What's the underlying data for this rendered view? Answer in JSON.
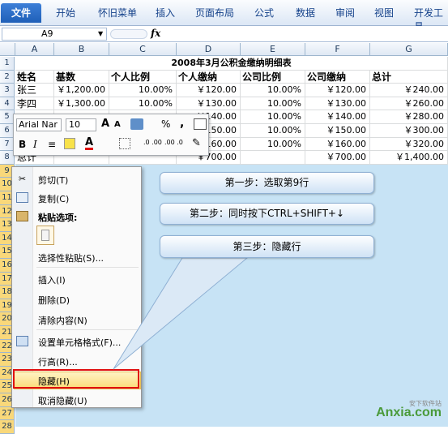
{
  "ribbon": {
    "file_tab": "文件",
    "tabs": [
      "开始",
      "怀旧菜单",
      "插入",
      "页面布局",
      "公式",
      "数据",
      "审阅",
      "视图",
      "开发工具"
    ]
  },
  "formula_bar": {
    "name_box": "A9",
    "fx": "fx"
  },
  "columns": [
    "A",
    "B",
    "C",
    "D",
    "E",
    "F",
    "G"
  ],
  "rows": [
    "1",
    "2",
    "3",
    "4",
    "5",
    "6",
    "7",
    "8",
    "9",
    "10",
    "11",
    "12",
    "13",
    "14",
    "15",
    "16",
    "17",
    "18",
    "19",
    "20",
    "21",
    "22",
    "23",
    "24",
    "25",
    "26",
    "27",
    "28"
  ],
  "sheet": {
    "title": "2008年3月公积金缴纳明细表",
    "headers": [
      "姓名",
      "基数",
      "个人比例",
      "个人缴纳",
      "公司比例",
      "公司缴纳",
      "总计"
    ],
    "data": [
      [
        "张三",
        "￥1,200.00",
        "10.00%",
        "￥120.00",
        "10.00%",
        "￥120.00",
        "￥240.00"
      ],
      [
        "李四",
        "￥1,300.00",
        "10.00%",
        "￥130.00",
        "10.00%",
        "￥130.00",
        "￥260.00"
      ],
      [
        "",
        "",
        "",
        "￥140.00",
        "10.00%",
        "￥140.00",
        "￥280.00"
      ],
      [
        "",
        "",
        "",
        "￥150.00",
        "10.00%",
        "￥150.00",
        "￥300.00"
      ],
      [
        "",
        "",
        "",
        "￥160.00",
        "10.00%",
        "￥160.00",
        "￥320.00"
      ],
      [
        "总计",
        "",
        "",
        "￥700.00",
        "",
        "￥700.00",
        "￥1,400.00"
      ]
    ]
  },
  "mini_toolbar": {
    "font": "Arial Nar",
    "size": "10",
    "grow": "A",
    "shrink": "A",
    "percent": "%",
    "comma": ",",
    "bold": "B",
    "italic": "I",
    "font_color": "A",
    "inc_decimal": ".0 .00",
    "dec_decimal": ".00 .0"
  },
  "context_menu": {
    "items": [
      {
        "label": "剪切(T)",
        "icon": "scissors-icon"
      },
      {
        "label": "复制(C)",
        "icon": "copy-icon"
      },
      {
        "label": "粘贴选项:",
        "icon": "paste-icon"
      },
      {
        "label": "选择性粘贴(S)...",
        "icon": ""
      },
      {
        "label": "插入(I)",
        "icon": ""
      },
      {
        "label": "删除(D)",
        "icon": ""
      },
      {
        "label": "清除内容(N)",
        "icon": ""
      },
      {
        "label": "设置单元格格式(F)...",
        "icon": "format-cells-icon"
      },
      {
        "label": "行高(R)...",
        "icon": ""
      },
      {
        "label": "隐藏(H)",
        "icon": ""
      },
      {
        "label": "取消隐藏(U)",
        "icon": ""
      }
    ]
  },
  "callouts": {
    "step1": "第一步：选取第9行",
    "step2": "第二步：同时按下CTRL+SHIFT+↓",
    "step3": "第三步：隐藏行"
  },
  "watermark": {
    "brand": "Anxia.com",
    "sub": "安下软件站"
  },
  "colors": {
    "highlight": "#fbdb76",
    "red_box": "#e01010",
    "selection_bg": "#c7e3f5"
  }
}
